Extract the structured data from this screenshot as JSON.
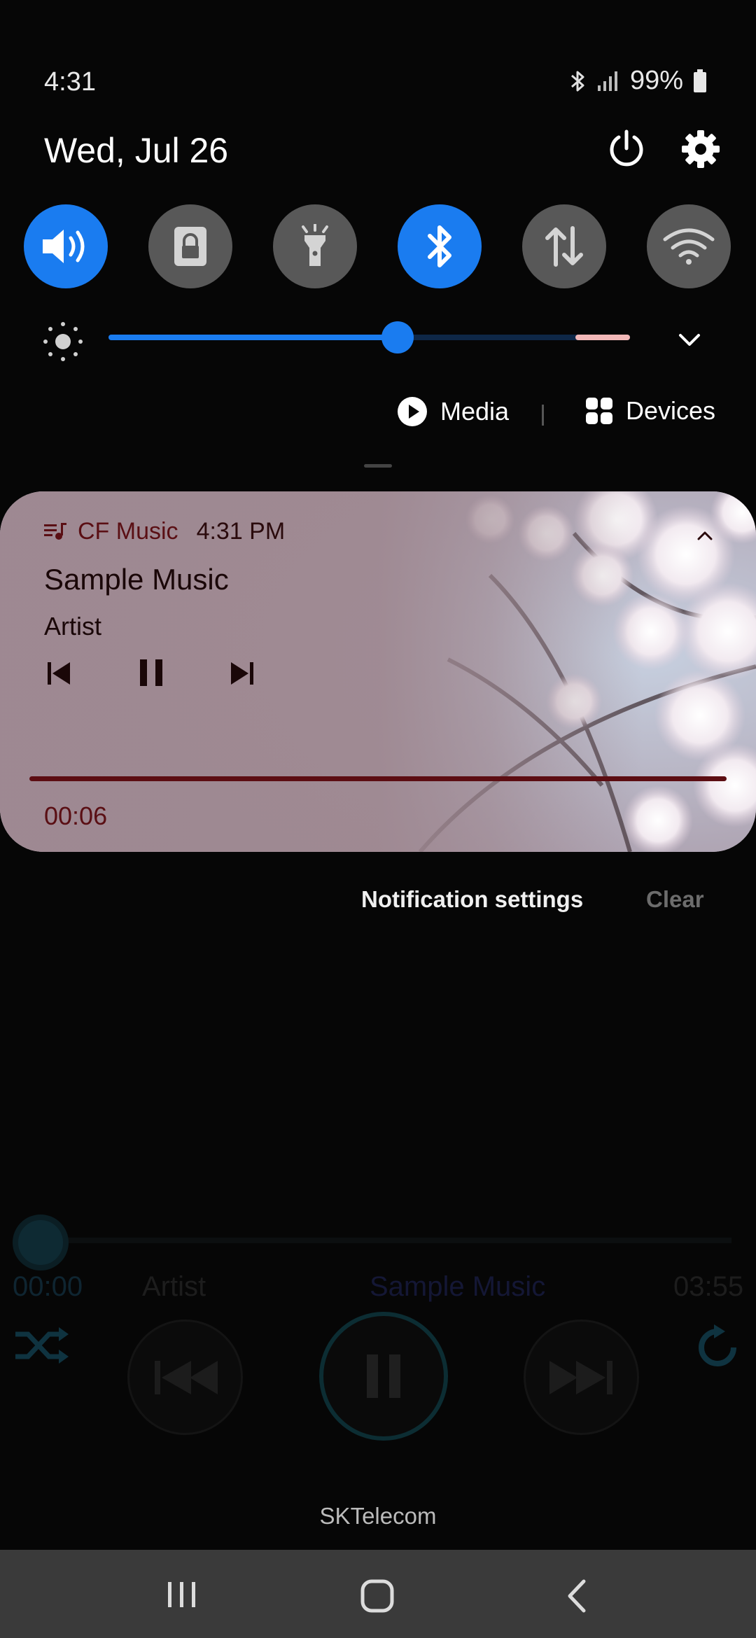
{
  "status_bar": {
    "time": "4:31",
    "battery_percent": "99%",
    "icons": [
      "bluetooth-icon",
      "signal-icon",
      "battery-icon"
    ]
  },
  "header": {
    "date": "Wed, Jul 26",
    "power_icon": "power-icon",
    "settings_icon": "gear-icon"
  },
  "quick_settings": [
    {
      "name": "sound",
      "icon": "volume-icon",
      "on": true
    },
    {
      "name": "screen-lock",
      "icon": "lock-icon",
      "on": false
    },
    {
      "name": "flashlight",
      "icon": "flashlight-icon",
      "on": false
    },
    {
      "name": "bluetooth",
      "icon": "bluetooth-icon",
      "on": true
    },
    {
      "name": "mobile-data",
      "icon": "data-arrows-icon",
      "on": false
    },
    {
      "name": "wifi",
      "icon": "wifi-icon",
      "on": false
    }
  ],
  "brightness": {
    "level_fraction": 0.55
  },
  "panel_buttons": {
    "media_label": "Media",
    "devices_label": "Devices"
  },
  "notification": {
    "app_name": "CF Music",
    "time": "4:31 PM",
    "title": "Sample Music",
    "artist": "Artist",
    "elapsed": "00:06",
    "progress_fraction": 1.0,
    "accent_color": "#5c0d12"
  },
  "notification_actions": {
    "settings_label": "Notification settings",
    "clear_label": "Clear"
  },
  "background_app": {
    "elapsed": "00:00",
    "artist": "Artist",
    "title": "Sample Music",
    "duration": "03:55"
  },
  "carrier": "SKTelecom",
  "colors": {
    "accent_blue": "#1a7cf0",
    "toggle_off": "#585858",
    "nav_bar": "#3a3a3a"
  }
}
